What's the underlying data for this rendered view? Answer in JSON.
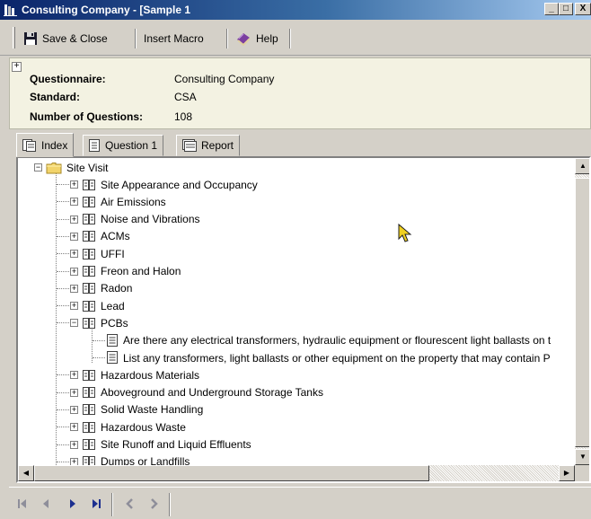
{
  "window": {
    "title": "Consulting Company - [Sample 1",
    "controls": {
      "minimize": "_",
      "maximize": "□",
      "close": "X"
    }
  },
  "toolbar": {
    "save_close_label": "Save & Close",
    "insert_macro_label": "Insert Macro",
    "help_label": "Help"
  },
  "info": {
    "expander": "+",
    "rows": [
      {
        "label": "Questionnaire:",
        "value": "Consulting Company"
      },
      {
        "label": "Standard:",
        "value": "CSA"
      },
      {
        "label": "Number of Questions:",
        "value": "108"
      }
    ]
  },
  "tabs": [
    {
      "label": "Index",
      "icon": "index-icon",
      "active": true
    },
    {
      "label": "Question 1",
      "icon": "document-icon",
      "active": false
    },
    {
      "label": "Report",
      "icon": "report-icon",
      "active": false
    }
  ],
  "tree": {
    "root": {
      "label": "Site Visit",
      "expander": "−",
      "icon": "folder-icon"
    },
    "items": [
      {
        "label": "Site Appearance and Occupancy",
        "expander": "+"
      },
      {
        "label": "Air Emissions",
        "expander": "+"
      },
      {
        "label": "Noise and Vibrations",
        "expander": "+"
      },
      {
        "label": "ACMs",
        "expander": "+"
      },
      {
        "label": "UFFI",
        "expander": "+"
      },
      {
        "label": "Freon and Halon",
        "expander": "+"
      },
      {
        "label": "Radon",
        "expander": "+"
      },
      {
        "label": "Lead",
        "expander": "+"
      },
      {
        "label": "PCBs",
        "expander": "−",
        "children": [
          "Are there any electrical transformers, hydraulic equipment or flourescent light ballasts on t",
          "List any transformers, light ballasts or other equipment on the property that may contain P"
        ]
      },
      {
        "label": "Hazardous Materials",
        "expander": "+"
      },
      {
        "label": "Aboveground and Underground Storage Tanks",
        "expander": "+"
      },
      {
        "label": "Solid Waste Handling",
        "expander": "+"
      },
      {
        "label": "Hazardous Waste",
        "expander": "+"
      },
      {
        "label": "Site Runoff and Liquid Effluents",
        "expander": "+"
      },
      {
        "label": "Dumps or Landfills",
        "expander": "+"
      }
    ]
  },
  "navigation": {
    "buttons": [
      "first-record-icon",
      "previous-record-icon",
      "next-record-icon",
      "last-record-icon",
      "back-icon",
      "forward-icon"
    ]
  },
  "colors": {
    "title_gradient_start": "#0a246a",
    "title_gradient_end": "#a6caf0",
    "info_background": "#f3f2e2",
    "nav_arrow": "#1c2f8f",
    "nav_arrow_disabled": "#8e8e9a",
    "cursor": "#f0d020"
  }
}
